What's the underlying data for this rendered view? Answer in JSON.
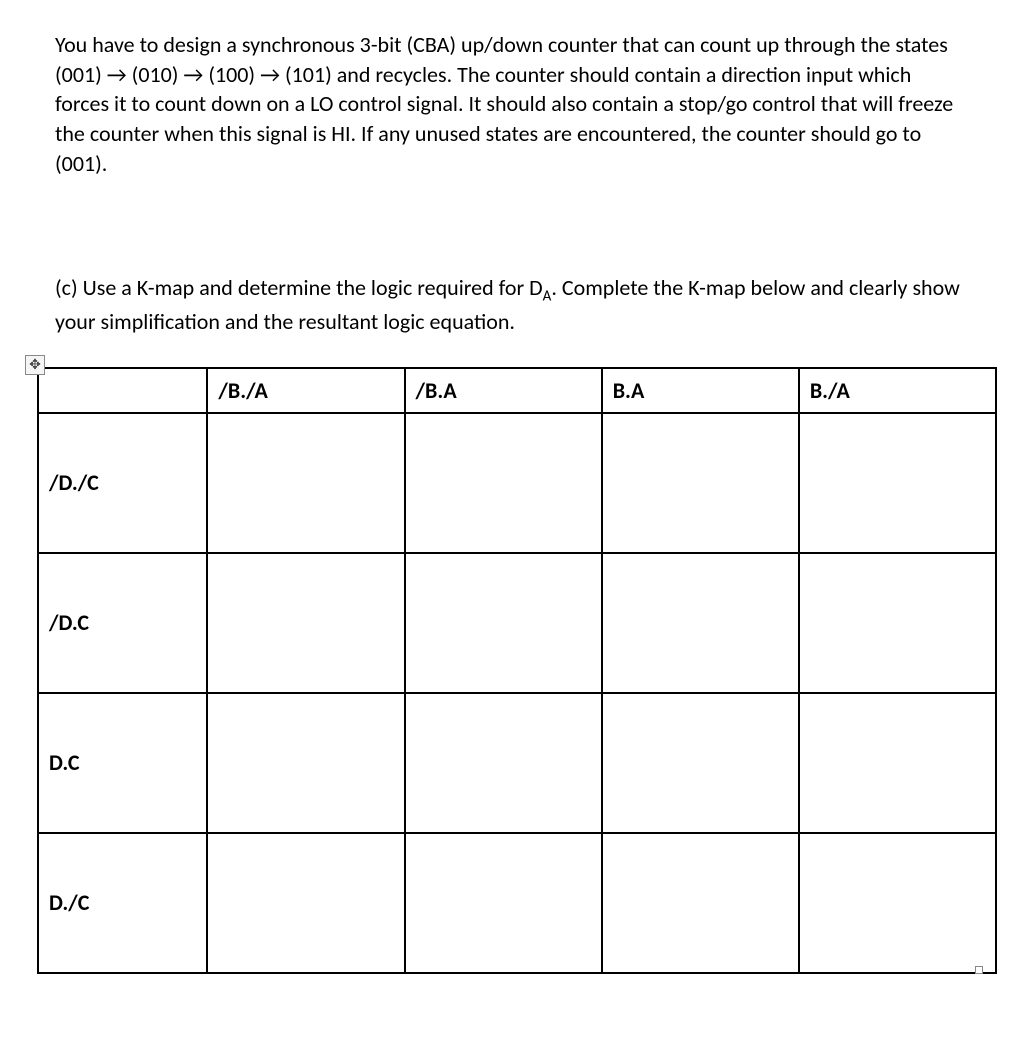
{
  "problem": {
    "text": "You have to design a synchronous 3-bit (CBA) up/down counter that can count up through the states (001) → (010)  → (100) → (101) and recycles. The counter should contain a direction input which forces it to count down on a LO control signal. It should also contain a stop/go control that will freeze the counter when this signal is HI. If any unused states are encountered, the counter should go to (001)."
  },
  "partC": {
    "prefix": "(c) Use a K-map and determine the logic required for D",
    "sub": "A",
    "suffix": ". Complete the K-map below and clearly show your simplification and the resultant logic equation."
  },
  "kmap": {
    "cols": [
      "/B./A",
      "/B.A",
      "B.A",
      "B./A"
    ],
    "rows": [
      "/D./C",
      "/D.C",
      "D.C",
      "D./C"
    ],
    "cells": [
      [
        "",
        "",
        "",
        ""
      ],
      [
        "",
        "",
        "",
        ""
      ],
      [
        "",
        "",
        "",
        ""
      ],
      [
        "",
        "",
        "",
        ""
      ]
    ]
  },
  "icons": {
    "move": "✥"
  }
}
